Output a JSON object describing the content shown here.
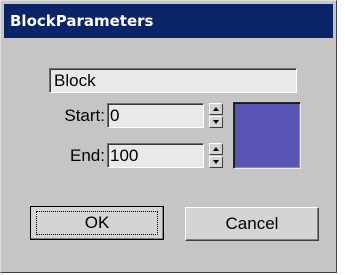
{
  "window": {
    "title": "BlockParameters"
  },
  "form": {
    "name_value": "Block",
    "start_label": "Start:",
    "start_value": "0",
    "end_label": "End:",
    "end_value": "100",
    "color_swatch_hex": "#5a55b5"
  },
  "buttons": {
    "ok_label": "OK",
    "cancel_label": "Cancel"
  },
  "icons": {
    "spin_up": "spin-up-arrow-icon",
    "spin_down": "spin-down-arrow-icon"
  }
}
